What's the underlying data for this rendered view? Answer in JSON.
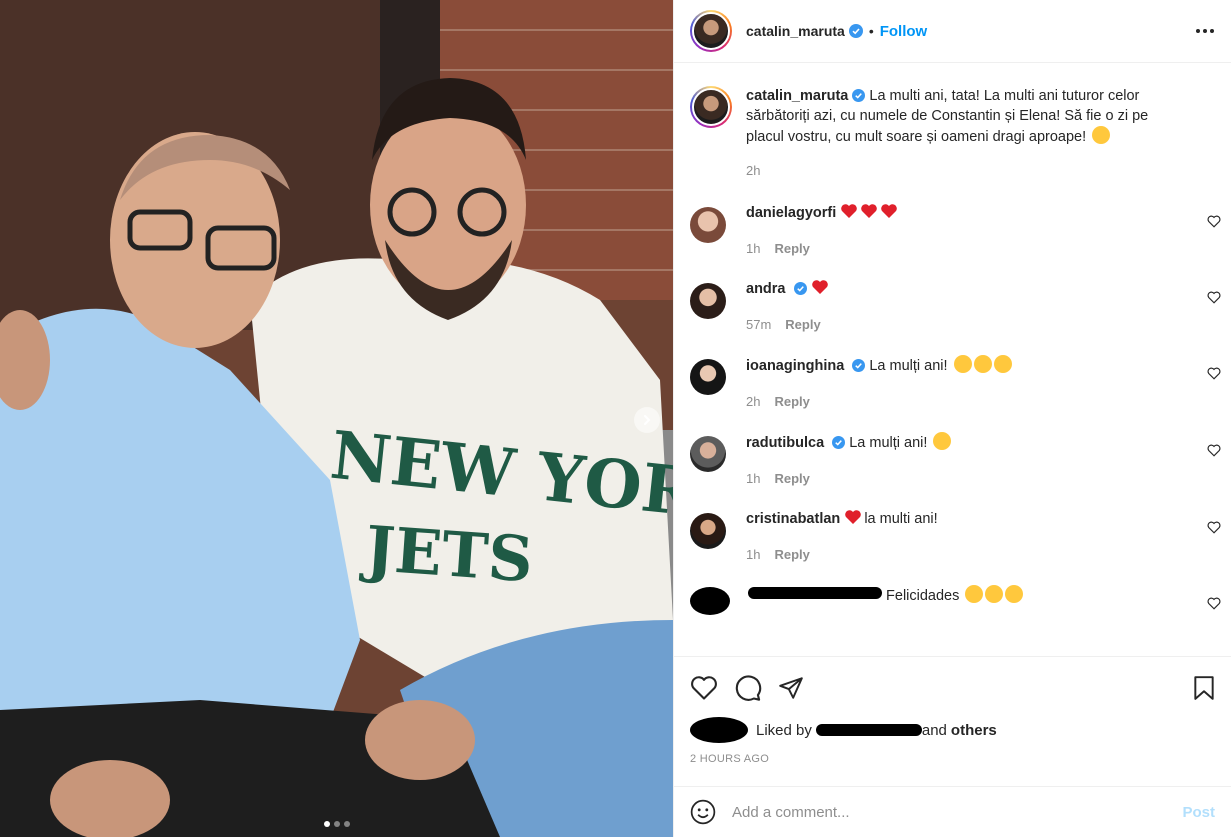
{
  "header": {
    "username": "catalin_maruta",
    "separator": "•",
    "follow_label": "Follow"
  },
  "caption": {
    "username": "catalin_maruta",
    "text": "La multi ani, tata! La multi ani tuturor celor sărbătoriți azi, cu numele de Constantin și Elena! Să fie o zi pe placul vostru, cu mult soare și oameni dragi aproape!",
    "time": "2h"
  },
  "image": {
    "shirt_text_line1": "NEW YORK",
    "shirt_text_line2": "JETS"
  },
  "comments": [
    {
      "username": "danielagyorfi",
      "verified": false,
      "text": "",
      "time": "1h",
      "reply": "Reply"
    },
    {
      "username": "andra",
      "verified": true,
      "text": "",
      "time": "57m",
      "reply": "Reply"
    },
    {
      "username": "ioanaginghina",
      "verified": true,
      "text": "La mulți ani!",
      "time": "2h",
      "reply": "Reply"
    },
    {
      "username": "radutibulca",
      "verified": true,
      "text": "La mulți ani!",
      "time": "1h",
      "reply": "Reply"
    },
    {
      "username": "cristinabatlan",
      "verified": false,
      "text": "la multi ani!",
      "time": "1h",
      "reply": "Reply"
    },
    {
      "username": "",
      "verified": false,
      "text": "Felicidades",
      "time": "",
      "reply": ""
    }
  ],
  "likes": {
    "prefix": "Liked by",
    "suffix": "and",
    "others": "others"
  },
  "post_time": "2 HOURS AGO",
  "add_comment": {
    "placeholder": "Add a comment...",
    "post_label": "Post"
  },
  "carousel": {
    "count": 3,
    "active": 1
  },
  "colors": {
    "accent": "#0095f6",
    "verified": "#3897f0",
    "heart": "#ed4956"
  }
}
